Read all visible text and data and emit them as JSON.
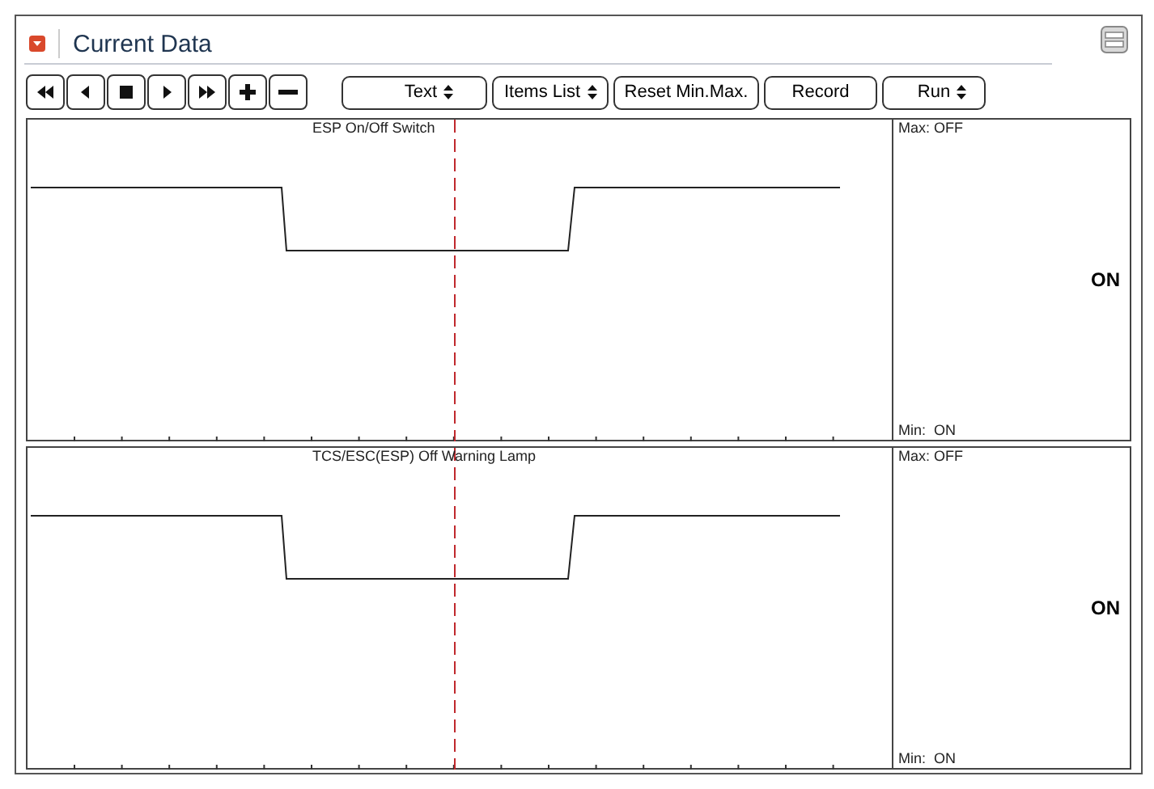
{
  "header": {
    "title": "Current Data"
  },
  "toolbar": {
    "nav_buttons": [
      {
        "kind": "first"
      },
      {
        "kind": "prev"
      },
      {
        "kind": "stop"
      },
      {
        "kind": "play"
      },
      {
        "kind": "last"
      },
      {
        "kind": "plus"
      },
      {
        "kind": "minus"
      }
    ],
    "controls": [
      {
        "kind": "dropdown",
        "label": "Text"
      },
      {
        "kind": "dropdown",
        "label": "Items List"
      },
      {
        "kind": "button",
        "label": "Reset Min.Max."
      },
      {
        "kind": "button",
        "label": "Record"
      },
      {
        "kind": "dropdown",
        "label": "Run"
      }
    ]
  },
  "panels": [
    {
      "title": "ESP On/Off Switch",
      "max": "Max: OFF",
      "min": "Min:  ON",
      "value": "ON"
    },
    {
      "title": "TCS/ESC(ESP) Off Warning Lamp",
      "max": "Max: OFF",
      "min": "Min:  ON",
      "value": "ON"
    }
  ]
}
